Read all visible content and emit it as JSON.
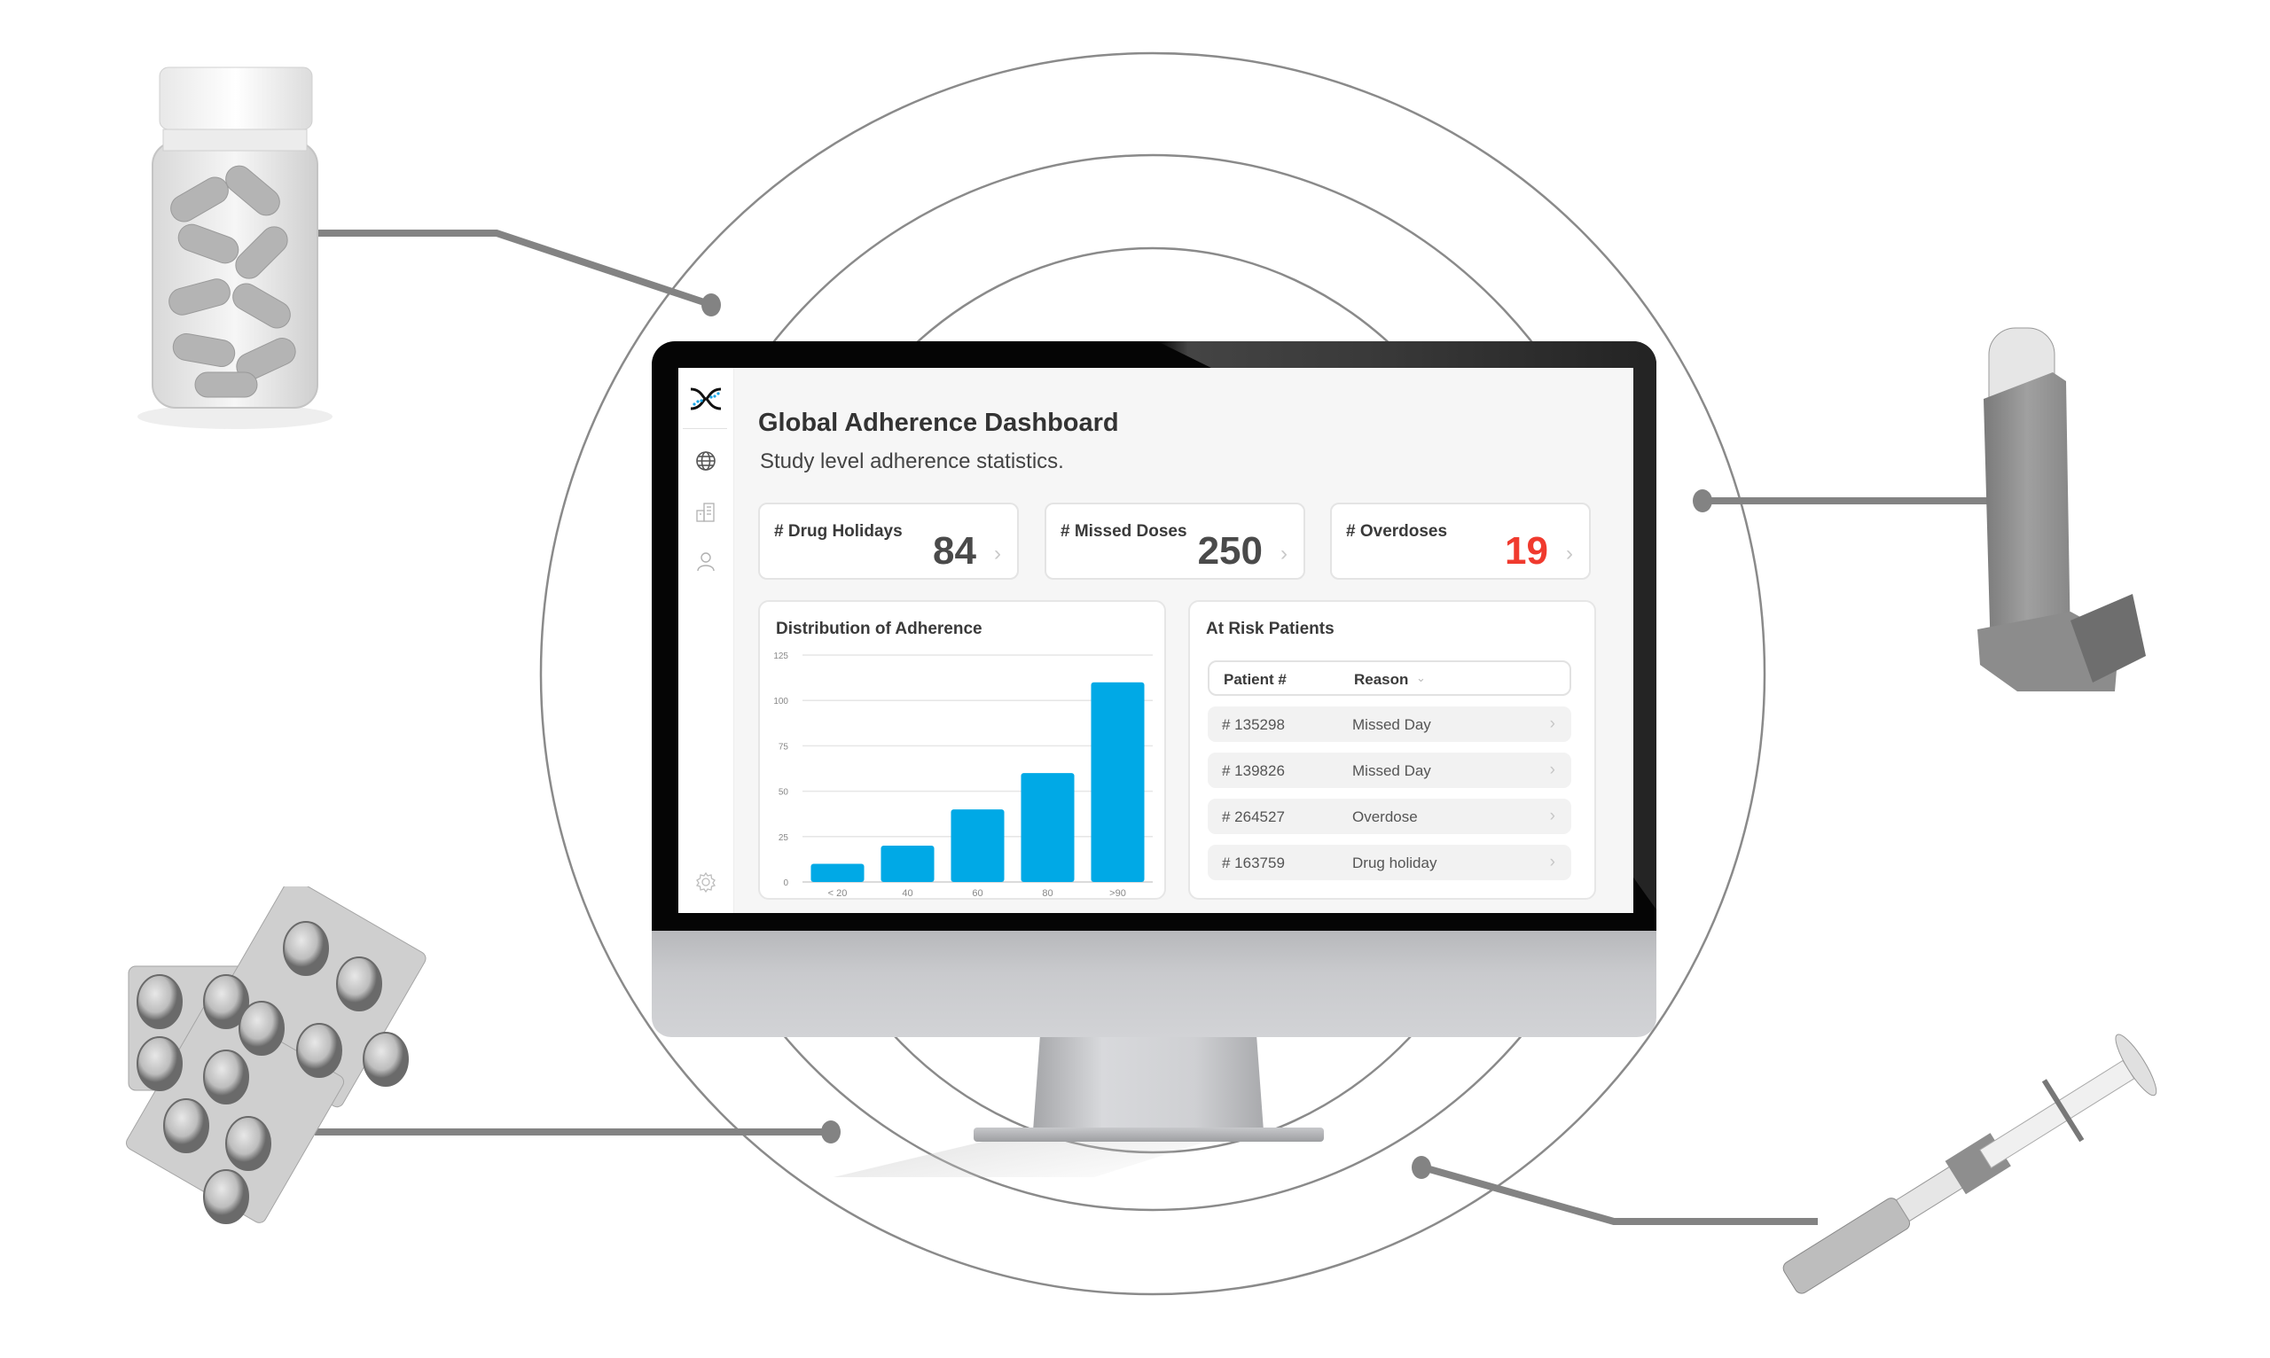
{
  "app": {
    "title": "Global Adherence Dashboard",
    "subtitle": "Study level adherence statistics."
  },
  "sidebar": {
    "items": [
      {
        "name": "globe",
        "icon": "globe-icon"
      },
      {
        "name": "sites",
        "icon": "building-icon"
      },
      {
        "name": "patients",
        "icon": "user-icon"
      },
      {
        "name": "settings",
        "icon": "gear-icon"
      }
    ]
  },
  "stats": [
    {
      "label": "# Drug Holidays",
      "value": "84",
      "alert": false
    },
    {
      "label": "# Missed Doses",
      "value": "250",
      "alert": false
    },
    {
      "label": "# Overdoses",
      "value": "19",
      "alert": true
    }
  ],
  "colors": {
    "accent": "#00a9e6",
    "alert": "#f03a2e"
  },
  "chart_data": {
    "type": "bar",
    "title": "Distribution of Adherence",
    "categories": [
      "< 20",
      "40",
      "60",
      "80",
      ">90"
    ],
    "values": [
      10,
      20,
      40,
      60,
      110
    ],
    "xlabel": "",
    "ylabel": "",
    "ylim": [
      0,
      125
    ],
    "yticks": [
      0,
      25,
      50,
      75,
      100,
      125
    ],
    "grid": true,
    "color": "#00a9e6"
  },
  "at_risk": {
    "title": "At Risk Patients",
    "columns": [
      "Patient #",
      "Reason"
    ],
    "sort_icon": "chevron-down-icon",
    "rows": [
      {
        "patient": "# 135298",
        "reason": "Missed Day"
      },
      {
        "patient": "# 139826",
        "reason": "Missed Day"
      },
      {
        "patient": "# 264527",
        "reason": "Overdose"
      },
      {
        "patient": "# 163759",
        "reason": "Drug holiday"
      }
    ],
    "row_chevron": "›"
  },
  "glyphs": {
    "chevron_right": "›",
    "chevron_down": "⌄"
  },
  "illustrations": [
    {
      "name": "pill-bottle"
    },
    {
      "name": "inhaler"
    },
    {
      "name": "blister-packs"
    },
    {
      "name": "syringe"
    }
  ]
}
